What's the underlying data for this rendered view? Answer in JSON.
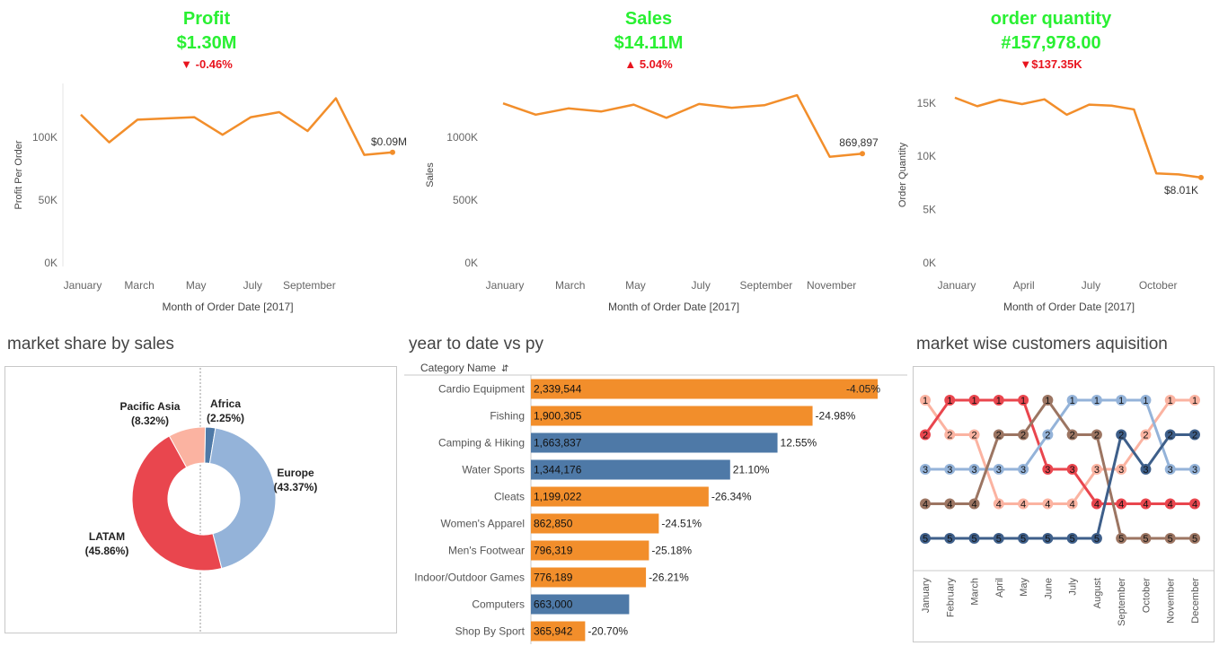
{
  "kpis": [
    {
      "title": "Profit",
      "value": "$1.30M",
      "delta": "-0.46%",
      "direction": "down"
    },
    {
      "title": "Sales",
      "value": "$14.11M",
      "delta": "5.04%",
      "direction": "up"
    },
    {
      "title": "order quantity",
      "value": "#157,978.00",
      "delta": "$137.35K",
      "direction": "down"
    }
  ],
  "sections": {
    "market_share": "market share by sales",
    "ytd": "year to date vs py",
    "acquisition": "market wise customers aquisition"
  },
  "colors": {
    "line": "#f28e2b",
    "kpi_green": "#29f032",
    "kpi_red": "#e8141e",
    "bar_orange": "#f28e2b",
    "bar_blue": "#4e79a7"
  },
  "chart_data": [
    {
      "type": "line",
      "xlabel": "Month of Order Date [2017]",
      "ylabel": "Profit Per Order",
      "x": [
        "January",
        "February",
        "March",
        "April",
        "May",
        "June",
        "July",
        "August",
        "September",
        "October",
        "November",
        "December"
      ],
      "xtick_labels": [
        "January",
        "March",
        "May",
        "July",
        "September"
      ],
      "ytick_labels": [
        "0K",
        "50K",
        "100K"
      ],
      "ylim": [
        0,
        140000
      ],
      "values": [
        118000,
        96000,
        114000,
        115000,
        116000,
        102000,
        116000,
        120000,
        105000,
        131000,
        86000,
        88000
      ],
      "end_label": "$0.09M"
    },
    {
      "type": "line",
      "xlabel": "Month of Order Date [2017]",
      "ylabel": "Sales",
      "x": [
        "January",
        "February",
        "March",
        "April",
        "May",
        "June",
        "July",
        "August",
        "September",
        "October",
        "November",
        "December"
      ],
      "xtick_labels": [
        "January",
        "March",
        "May",
        "July",
        "September",
        "November"
      ],
      "ytick_labels": [
        "0K",
        "500K",
        "1000K"
      ],
      "ylim": [
        0,
        1400000
      ],
      "values": [
        1270000,
        1180000,
        1230000,
        1205000,
        1260000,
        1155000,
        1265000,
        1235000,
        1255000,
        1335000,
        845000,
        869897
      ],
      "end_label": "869,897"
    },
    {
      "type": "line",
      "xlabel": "Month of Order Date [2017]",
      "ylabel": "Order Quantity",
      "x": [
        "January",
        "February",
        "March",
        "April",
        "May",
        "June",
        "July",
        "August",
        "September",
        "October",
        "November",
        "December"
      ],
      "xtick_labels": [
        "January",
        "April",
        "July",
        "October"
      ],
      "ytick_labels": [
        "0K",
        "5K",
        "10K",
        "15K"
      ],
      "ylim": [
        0,
        16500
      ],
      "values": [
        15500,
        14700,
        15300,
        14900,
        15350,
        13900,
        14850,
        14750,
        14400,
        8400,
        8300,
        8010
      ],
      "end_label": "$8.01K"
    },
    {
      "type": "pie",
      "slices": [
        {
          "name": "Africa",
          "value": 2.25,
          "label": "(2.25%)",
          "color": "#4e79a7"
        },
        {
          "name": "Europe",
          "value": 43.37,
          "label": "(43.37%)",
          "color": "#94b3d9"
        },
        {
          "name": "LATAM",
          "value": 45.86,
          "label": "(45.86%)",
          "color": "#e9464e"
        },
        {
          "name": "Pacific Asia",
          "value": 8.32,
          "label": "(8.32%)",
          "color": "#fbb3a1"
        }
      ]
    },
    {
      "type": "bar",
      "header": "Category Name",
      "categories": [
        "Cardio Equipment",
        "Fishing",
        "Camping & Hiking",
        "Water Sports",
        "Cleats",
        "Women's Apparel",
        "Men's Footwear",
        "Indoor/Outdoor Games",
        "Computers",
        "Shop By Sport"
      ],
      "values": [
        2339544,
        1900305,
        1663837,
        1344176,
        1199022,
        862850,
        796319,
        776189,
        663000,
        365942
      ],
      "value_labels": [
        "2,339,544",
        "1,900,305",
        "1,663,837",
        "1,344,176",
        "1,199,022",
        "862,850",
        "796,319",
        "776,189",
        "663,000",
        "365,942"
      ],
      "pct_labels": [
        "-4.05%",
        "-24.98%",
        "12.55%",
        "21.10%",
        "-26.34%",
        "-24.51%",
        "-25.18%",
        "-26.21%",
        "",
        "-20.70%"
      ],
      "colors": [
        "orange",
        "orange",
        "blue",
        "blue",
        "orange",
        "orange",
        "orange",
        "orange",
        "blue",
        "orange"
      ],
      "xlim": [
        0,
        2400000
      ]
    },
    {
      "type": "line",
      "x": [
        "January",
        "February",
        "March",
        "April",
        "May",
        "June",
        "July",
        "August",
        "September",
        "October",
        "November",
        "December"
      ],
      "series": [
        {
          "color": "#fbb3a1",
          "values": [
            1,
            2,
            2,
            4,
            4,
            4,
            4,
            3,
            3,
            2,
            1,
            1
          ]
        },
        {
          "color": "#e9464e",
          "values": [
            2,
            1,
            1,
            1,
            1,
            3,
            3,
            4,
            4,
            4,
            4,
            4
          ]
        },
        {
          "color": "#94b3d9",
          "values": [
            3,
            3,
            3,
            3,
            3,
            2,
            1,
            1,
            1,
            1,
            3,
            3
          ]
        },
        {
          "color": "#9c7562",
          "values": [
            4,
            4,
            4,
            2,
            2,
            1,
            2,
            2,
            5,
            5,
            5,
            5
          ]
        },
        {
          "color": "#3e5f8a",
          "values": [
            5,
            5,
            5,
            5,
            5,
            5,
            5,
            5,
            2,
            3,
            2,
            2
          ]
        }
      ],
      "ylim": [
        1,
        5
      ]
    }
  ]
}
